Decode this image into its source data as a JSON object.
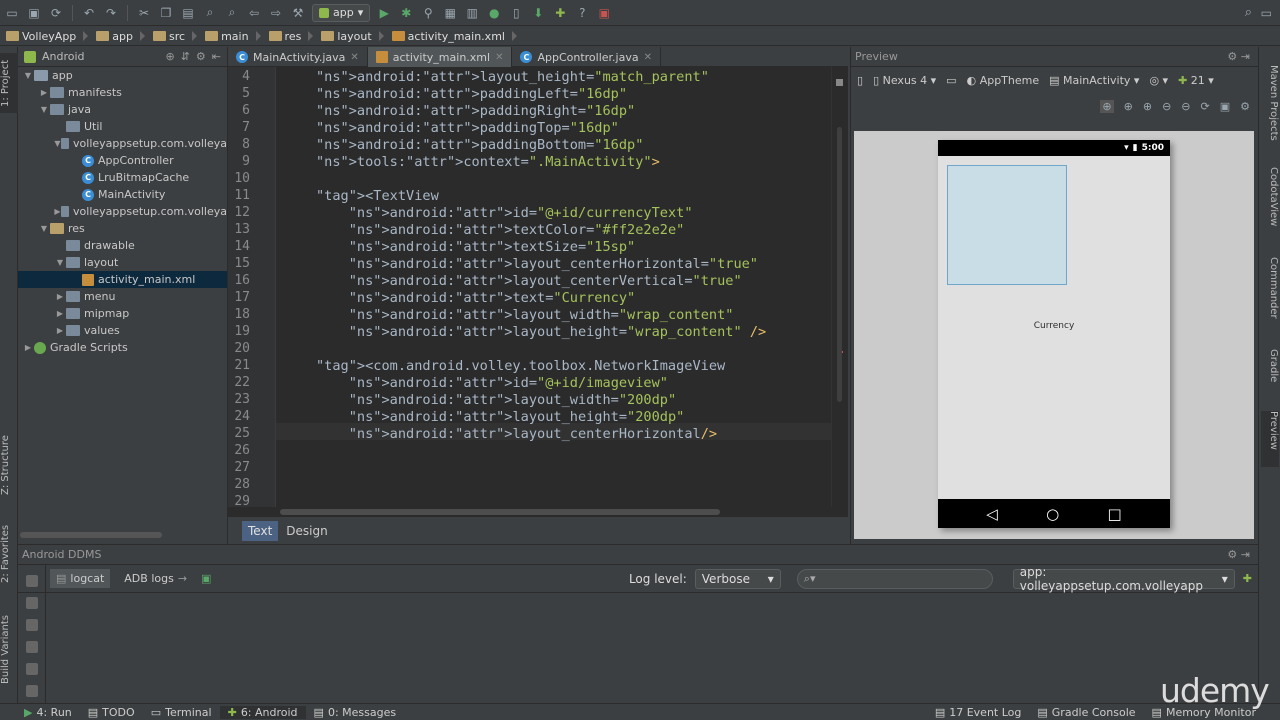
{
  "toolbar": {
    "run_config": "app"
  },
  "breadcrumbs": [
    "VolleyApp",
    "app",
    "src",
    "main",
    "res",
    "layout",
    "activity_main.xml"
  ],
  "project": {
    "view_mode": "Android",
    "tree": [
      {
        "label": "app",
        "level": 0,
        "expanded": true,
        "kind": "module"
      },
      {
        "label": "manifests",
        "level": 1,
        "expanded": false,
        "kind": "folder"
      },
      {
        "label": "java",
        "level": 1,
        "expanded": true,
        "kind": "folder"
      },
      {
        "label": "Util",
        "level": 2,
        "kind": "package"
      },
      {
        "label": "volleyappsetup.com.volleya",
        "level": 2,
        "expanded": true,
        "kind": "package"
      },
      {
        "label": "AppController",
        "level": 3,
        "kind": "class"
      },
      {
        "label": "LruBitmapCache",
        "level": 3,
        "kind": "class"
      },
      {
        "label": "MainActivity",
        "level": 3,
        "kind": "class"
      },
      {
        "label": "volleyappsetup.com.volleya",
        "level": 2,
        "expanded": false,
        "kind": "package"
      },
      {
        "label": "res",
        "level": 1,
        "expanded": true,
        "kind": "res"
      },
      {
        "label": "drawable",
        "level": 2,
        "kind": "folder"
      },
      {
        "label": "layout",
        "level": 2,
        "expanded": true,
        "kind": "folder"
      },
      {
        "label": "activity_main.xml",
        "level": 3,
        "kind": "xml",
        "selected": true
      },
      {
        "label": "menu",
        "level": 2,
        "expanded": false,
        "kind": "folder"
      },
      {
        "label": "mipmap",
        "level": 2,
        "expanded": false,
        "kind": "folder"
      },
      {
        "label": "values",
        "level": 2,
        "expanded": false,
        "kind": "folder"
      },
      {
        "label": "Gradle Scripts",
        "level": 0,
        "expanded": false,
        "kind": "gradle"
      }
    ]
  },
  "editor_tabs": [
    {
      "label": "MainActivity.java",
      "active": false
    },
    {
      "label": "activity_main.xml",
      "active": true
    },
    {
      "label": "AppController.java",
      "active": false
    }
  ],
  "code_lines": [
    {
      "n": "4",
      "text": "android:layout_height=\"match_parent\""
    },
    {
      "n": "5",
      "text": "android:paddingLeft=\"16dp\""
    },
    {
      "n": "6",
      "text": "android:paddingRight=\"16dp\""
    },
    {
      "n": "7",
      "text": "android:paddingTop=\"16dp\""
    },
    {
      "n": "8",
      "text": "android:paddingBottom=\"16dp\""
    },
    {
      "n": "9",
      "text": "tools:context=\".MainActivity\">"
    },
    {
      "n": "10",
      "text": ""
    },
    {
      "n": "11",
      "text": "<TextView"
    },
    {
      "n": "12",
      "text": "    android:id=\"@+id/currencyText\""
    },
    {
      "n": "13",
      "text": "    android:textColor=\"#ff2e2e2e\""
    },
    {
      "n": "14",
      "text": "    android:textSize=\"15sp\""
    },
    {
      "n": "15",
      "text": "    android:layout_centerHorizontal=\"true\""
    },
    {
      "n": "16",
      "text": "    android:layout_centerVertical=\"true\""
    },
    {
      "n": "17",
      "text": "    android:text=\"Currency\""
    },
    {
      "n": "18",
      "text": "    android:layout_width=\"wrap_content\""
    },
    {
      "n": "19",
      "text": "    android:layout_height=\"wrap_content\" />"
    },
    {
      "n": "20",
      "text": ""
    },
    {
      "n": "21",
      "text": "<com.android.volley.toolbox.NetworkImageView"
    },
    {
      "n": "22",
      "text": "    android:id=\"@+id/imageview\""
    },
    {
      "n": "23",
      "text": "    android:layout_width=\"200dp\""
    },
    {
      "n": "24",
      "text": "    android:layout_height=\"200dp\""
    },
    {
      "n": "25",
      "text": "    android:layout_centerHorizontal/>"
    },
    {
      "n": "26",
      "text": ""
    },
    {
      "n": "27",
      "text": ""
    },
    {
      "n": "28",
      "text": ""
    },
    {
      "n": "29",
      "text": ""
    }
  ],
  "editor_mode_tabs": {
    "text": "Text",
    "design": "Design"
  },
  "preview": {
    "title": "Preview",
    "device": "Nexus 4",
    "theme": "AppTheme",
    "activity": "MainActivity",
    "api": "21",
    "status_time": "5:00",
    "currency_text": "Currency"
  },
  "ddms": {
    "title": "Android DDMS",
    "tab_logcat": "logcat",
    "tab_adb": "ADB logs",
    "log_level_label": "Log level:",
    "log_level_value": "Verbose",
    "app_filter": "app: volleyappsetup.com.volleyapp"
  },
  "left_tool_tabs": {
    "project": "1: Project",
    "structure": "Z: Structure",
    "favorites": "2: Favorites",
    "build_variants": "Build Variants"
  },
  "right_tool_tabs": {
    "maven": "Maven Projects",
    "codota": "CodotaView",
    "commander": "Commander",
    "gradle": "Gradle",
    "preview": "Preview"
  },
  "bottom_bar": {
    "run": "4: Run",
    "todo": "TODO",
    "terminal": "Terminal",
    "android": "6: Android",
    "messages": "0: Messages",
    "event_log": "17 Event Log",
    "gradle_console": "Gradle Console",
    "memory_monitor": "Memory Monitor"
  },
  "watermark": "udemy",
  "colors": {
    "accent": "#4b6283",
    "selection": "#0d293e",
    "editor_bg": "#2b2b2b"
  }
}
